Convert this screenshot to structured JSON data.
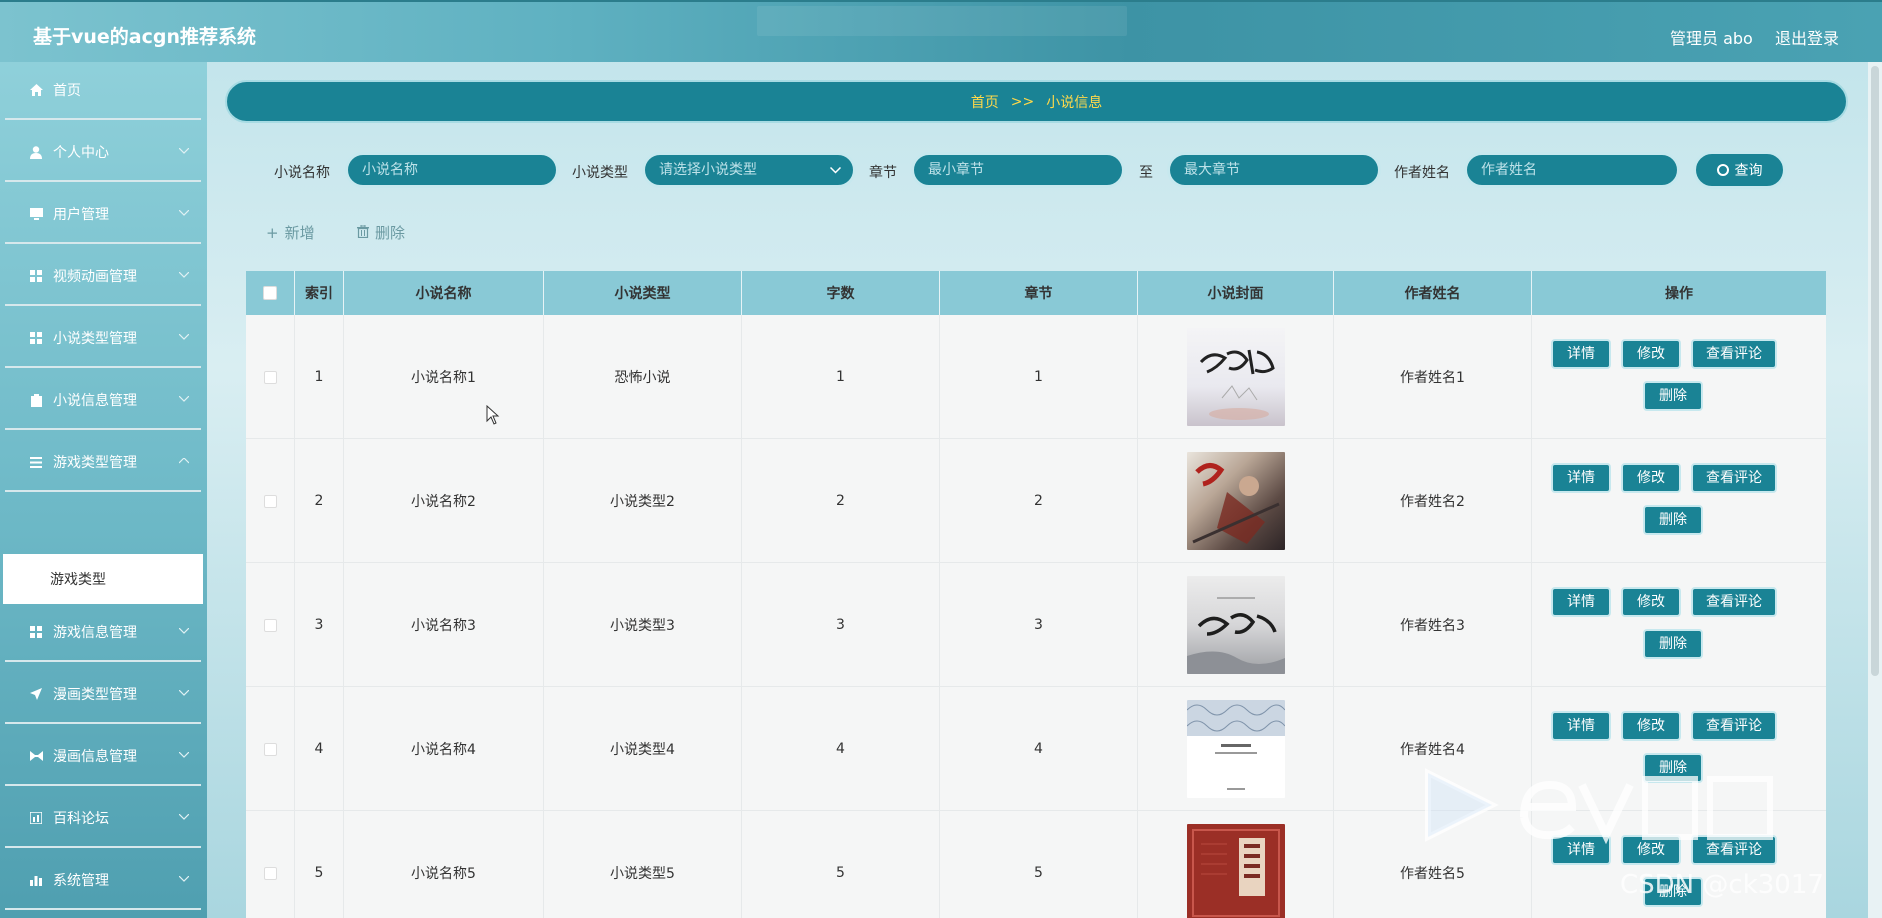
{
  "header": {
    "title": "基于vue的acgn推荐系统",
    "admin": "管理员 abo",
    "logout": "退出登录"
  },
  "sidebar": {
    "items": [
      {
        "label": "首页",
        "icon": "home-icon"
      },
      {
        "label": "个人中心",
        "icon": "user-icon"
      },
      {
        "label": "用户管理",
        "icon": "monitor-icon"
      },
      {
        "label": "视频动画管理",
        "icon": "grid-icon"
      },
      {
        "label": "小说类型管理",
        "icon": "grid-icon"
      },
      {
        "label": "小说信息管理",
        "icon": "clipboard-icon"
      },
      {
        "label": "游戏类型管理",
        "icon": "list-icon"
      },
      {
        "label": "游戏信息管理",
        "icon": "grid-icon"
      },
      {
        "label": "漫画类型管理",
        "icon": "send-icon"
      },
      {
        "label": "漫画信息管理",
        "icon": "bowtie-icon"
      },
      {
        "label": "百科论坛",
        "icon": "chart-icon"
      },
      {
        "label": "系统管理",
        "icon": "bar-chart-icon"
      }
    ],
    "sub_item": "游戏类型"
  },
  "breadcrumb": {
    "home": "首页",
    "sep": ">>",
    "current": "小说信息"
  },
  "search": {
    "name_label": "小说名称",
    "name_placeholder": "小说名称",
    "type_label": "小说类型",
    "type_placeholder": "请选择小说类型",
    "chapter_label": "章节",
    "chapter_min_placeholder": "最小章节",
    "to": "至",
    "chapter_max_placeholder": "最大章节",
    "author_label": "作者姓名",
    "author_placeholder": "作者姓名",
    "query_label": "查询"
  },
  "toolbar": {
    "add_label": "新增",
    "delete_label": "删除"
  },
  "table": {
    "headers": [
      "索引",
      "小说名称",
      "小说类型",
      "字数",
      "章节",
      "小说封面",
      "作者姓名",
      "操作"
    ],
    "rows": [
      {
        "index": "1",
        "name": "小说名称1",
        "type": "恐怖小说",
        "words": "1",
        "chapter": "1",
        "author": "作者姓名1"
      },
      {
        "index": "2",
        "name": "小说名称2",
        "type": "小说类型2",
        "words": "2",
        "chapter": "2",
        "author": "作者姓名2"
      },
      {
        "index": "3",
        "name": "小说名称3",
        "type": "小说类型3",
        "words": "3",
        "chapter": "3",
        "author": "作者姓名3"
      },
      {
        "index": "4",
        "name": "小说名称4",
        "type": "小说类型4",
        "words": "4",
        "chapter": "4",
        "author": "作者姓名4"
      },
      {
        "index": "5",
        "name": "小说名称5",
        "type": "小说类型5",
        "words": "5",
        "chapter": "5",
        "author": "作者姓名5"
      }
    ],
    "actions": {
      "detail": "详情",
      "edit": "修改",
      "comments": "查看评论",
      "delete": "删除"
    }
  },
  "watermark": {
    "text": "CSDN @ck3017"
  },
  "colors": {
    "accent": "#1a8395",
    "breadcrumb_text": "#ffd94a",
    "header_row": "#89c9d6"
  }
}
